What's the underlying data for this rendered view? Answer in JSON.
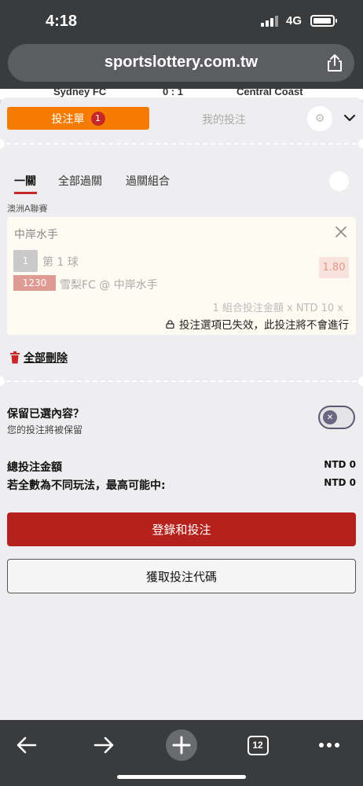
{
  "status_bar": {
    "time": "4:18",
    "network": "4G"
  },
  "browser": {
    "url": "sportslottery.com.tw"
  },
  "peek": {
    "home_team": "Sydney FC",
    "score": "0 : 1",
    "away_team": "Central Coast"
  },
  "betslip": {
    "tab_active": "投注單",
    "badge_count": "1",
    "tab_inactive": "我的投注",
    "subtabs": [
      "一關",
      "全部過關",
      "過關組合"
    ],
    "league": "澳洲A聯賽",
    "selection": {
      "team": "中岸水手",
      "market_num": "1",
      "market": "第 1 球",
      "odds": "1.80",
      "match_id": "1230",
      "match": "雪梨FC @ 中岸水手",
      "amount_line": "1 組合投注金額 x NTD 10 x",
      "invalid_notice": "投注選項已失效，此投注將不會進行"
    },
    "delete_all": "全部刪除",
    "keep": {
      "title": "保留已選內容？",
      "subtitle": "您的投注將被保留"
    },
    "totals": {
      "total_label": "總投注金額",
      "total_value": "NTD 0",
      "max_label": "若全數為不同玩法，最高可能中:",
      "max_value": "NTD 0"
    },
    "login_button": "登錄和投注",
    "code_button": "獲取投注代碼"
  },
  "toolbar": {
    "tabs_count": "12"
  },
  "colors": {
    "accent_orange": "#f57c00",
    "primary_red": "#b5221d",
    "badge_red": "#c62828"
  }
}
